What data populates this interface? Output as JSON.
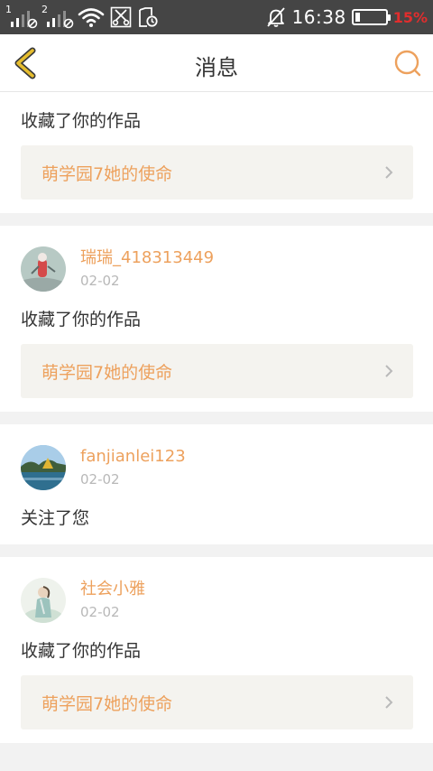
{
  "status_bar": {
    "sim1": "1",
    "sim2": "2",
    "time": "16:38",
    "battery_percent": "15%",
    "battery_level": 0.15
  },
  "header": {
    "title": "消息"
  },
  "notifications": [
    {
      "action": "收藏了你的作品",
      "work_title": "萌学园7她的使命"
    },
    {
      "user": "瑞瑞_418313449",
      "date": "02-02",
      "action": "收藏了你的作品",
      "work_title": "萌学园7她的使命"
    },
    {
      "user": "fanjianlei123",
      "date": "02-02",
      "action": "关注了您"
    },
    {
      "user": "社会小雅",
      "date": "02-02",
      "action": "收藏了你的作品",
      "work_title": "萌学园7她的使命"
    }
  ],
  "colors": {
    "accent": "#eda15d",
    "back_arrow": "#e6bd2e",
    "status_bar": "#454545"
  }
}
